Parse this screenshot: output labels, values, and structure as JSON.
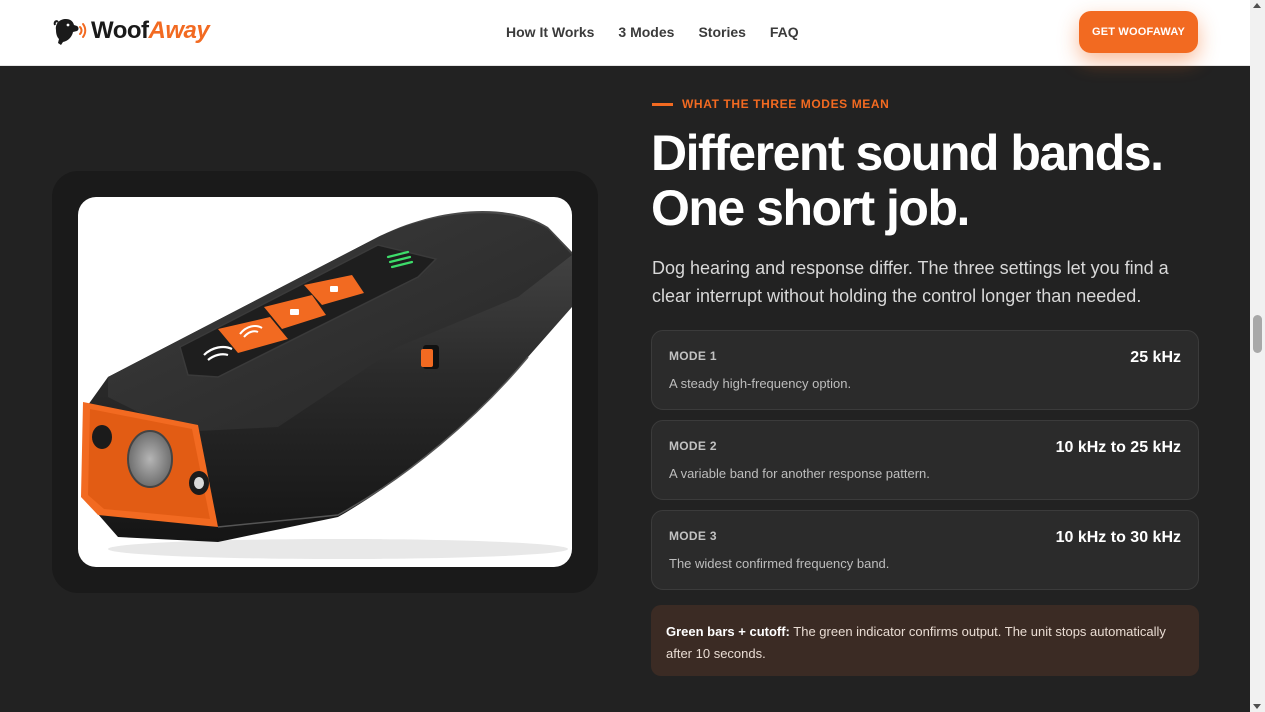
{
  "brand": {
    "part1": "Woof",
    "part2": "Away",
    "logo_icon": "dog-head-sound-waves-icon"
  },
  "nav": {
    "items": [
      "How It Works",
      "3 Modes",
      "Stories",
      "FAQ"
    ]
  },
  "header": {
    "cta_label": "GET WOOFAWAY"
  },
  "section": {
    "eyebrow": "WHAT THE THREE MODES MEAN",
    "headline_line1": "Different sound bands.",
    "headline_line2": "One short job.",
    "intro": "Dog hearing and response differ. The three settings let you find a clear interrupt without holding the control longer than needed."
  },
  "modes": [
    {
      "label": "MODE 1",
      "frequency": "25 kHz",
      "description": "A steady high-frequency option."
    },
    {
      "label": "MODE 2",
      "frequency": "10 kHz to 25 kHz",
      "description": "A variable band for another response pattern."
    },
    {
      "label": "MODE 3",
      "frequency": "10 kHz to 30 kHz",
      "description": "The widest confirmed frequency band."
    }
  ],
  "note": {
    "title": "Green bars + cutoff:",
    "text": "The green indicator confirms output. The unit stops automatically after 10 seconds."
  },
  "colors": {
    "accent": "#f26a21",
    "background": "#222222",
    "indicator_green": "#3ddc6a"
  }
}
